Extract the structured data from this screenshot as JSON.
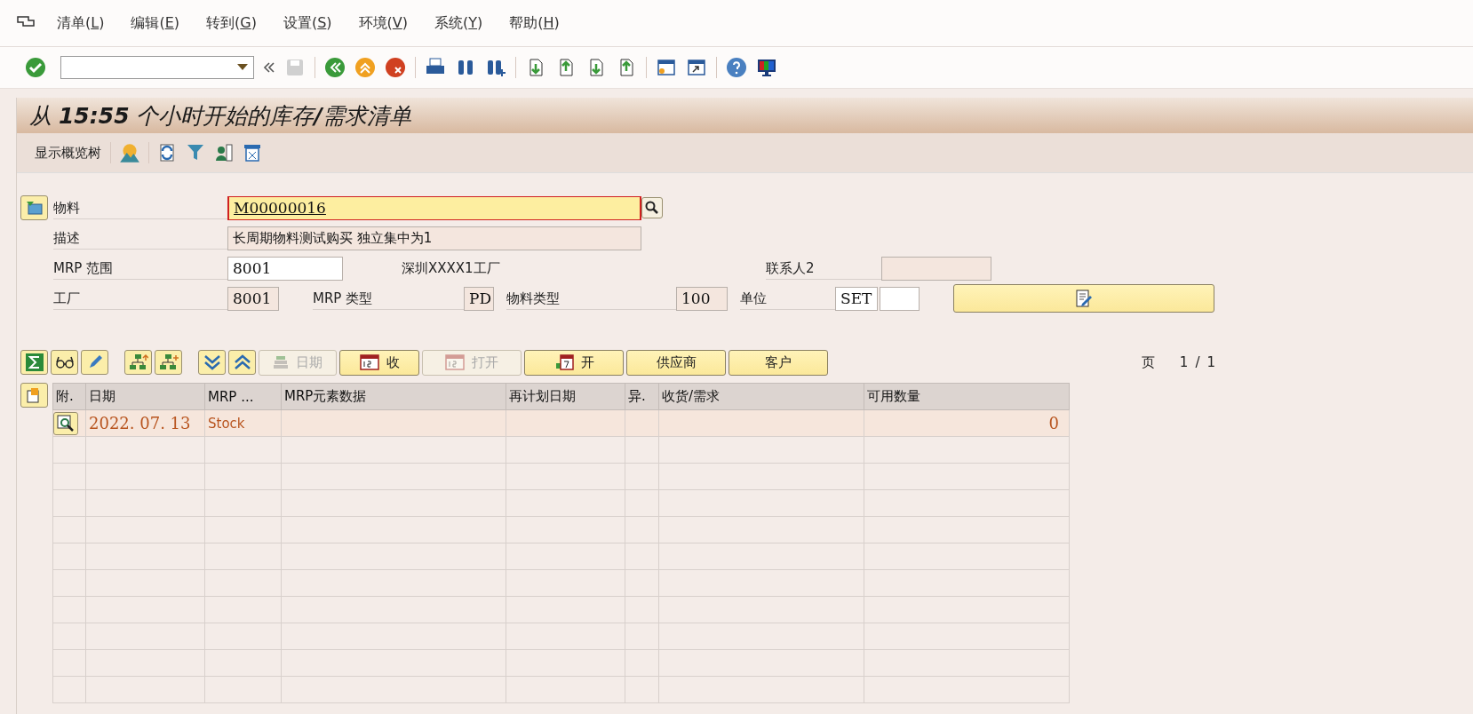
{
  "menu_bar": {
    "items": [
      {
        "before": "清单(",
        "mnemonic": "L",
        "after": ")"
      },
      {
        "before": "编辑(",
        "mnemonic": "E",
        "after": ")"
      },
      {
        "before": "转到(",
        "mnemonic": "G",
        "after": ")"
      },
      {
        "before": "设置(",
        "mnemonic": "S",
        "after": ")"
      },
      {
        "before": "环境(",
        "mnemonic": "V",
        "after": ")"
      },
      {
        "before": "系统(",
        "mnemonic": "Y",
        "after": ")"
      },
      {
        "before": "帮助(",
        "mnemonic": "H",
        "after": ")"
      }
    ]
  },
  "toolbar": {
    "save_disabled": true
  },
  "title": "从 **15:55** 个小时开始的库存**/**需求清单",
  "app_toolbar": {
    "button": "显示概览树"
  },
  "form": {
    "material": {
      "label": "物料",
      "value": "M00000016"
    },
    "description": {
      "label": "描述",
      "value": "长周期物料测试购买 独立集中为1"
    },
    "mrp_area": {
      "label": "MRP 范围",
      "value": "8001",
      "name": "深圳XXXX1工厂"
    },
    "contact": {
      "label": "联系人2"
    },
    "plant": {
      "label": "工厂",
      "value": "8001"
    },
    "mrp_type": {
      "label": "MRP 类型",
      "value": "PD"
    },
    "material_type": {
      "label": "物料类型",
      "value": "100"
    },
    "unit": {
      "label": "单位",
      "value": "SET"
    }
  },
  "table_toolbar": {
    "buttons": [
      {
        "label": "日期",
        "disabled": true,
        "kind": "stack"
      },
      {
        "label": "收",
        "disabled": false,
        "kind": "calendar"
      },
      {
        "label": "打开",
        "disabled": true,
        "kind": "calendar"
      },
      {
        "label": "开",
        "disabled": false,
        "kind": "calendar7"
      },
      {
        "label": "供应商",
        "disabled": false,
        "kind": "plain"
      },
      {
        "label": "客户",
        "disabled": false,
        "kind": "plain"
      }
    ]
  },
  "pager": {
    "label": "页",
    "current": "1",
    "separator": "/",
    "total": "1"
  },
  "table": {
    "columns": [
      "附.",
      "日期",
      "MRP ...",
      "MRP元素数据",
      "再计划日期",
      "异.",
      "收货/需求",
      "可用数量"
    ],
    "rows": [
      {
        "date": "2022. 07. 13",
        "mrp_element": "Stock",
        "available_quantity": "0"
      }
    ]
  }
}
